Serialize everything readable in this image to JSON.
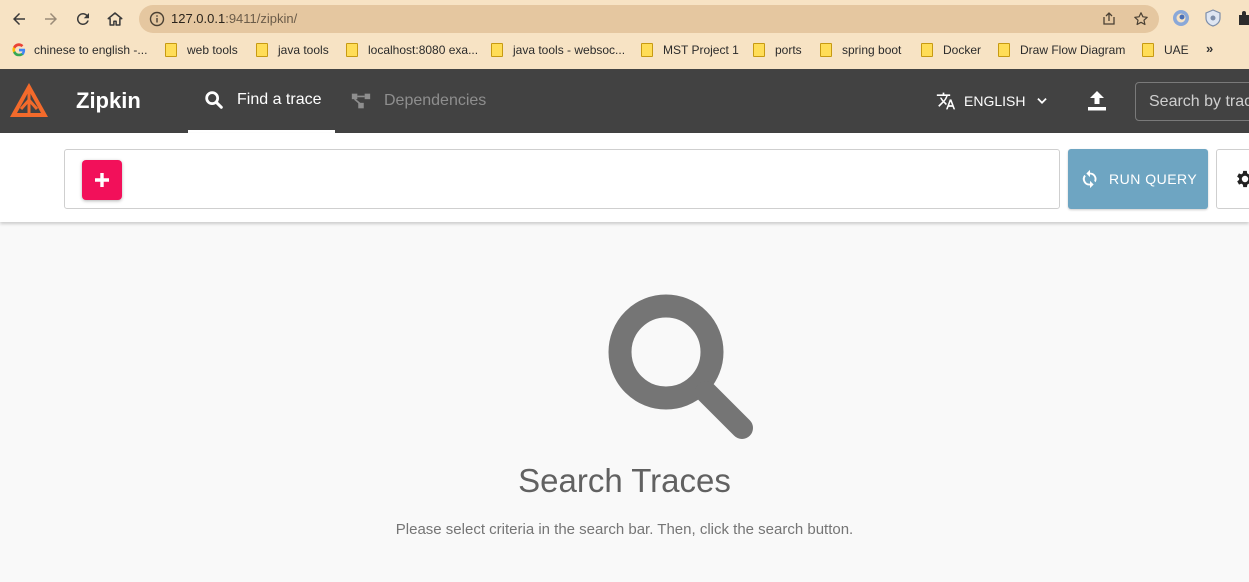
{
  "browser": {
    "url_host": "127.0.0.1",
    "url_port_path": ":9411/zipkin/",
    "bookmarks": [
      {
        "label": "chinese to english -..."
      },
      {
        "label": "web tools"
      },
      {
        "label": "java tools"
      },
      {
        "label": "localhost:8080 exa..."
      },
      {
        "label": "java tools - websoc..."
      },
      {
        "label": "MST Project 1"
      },
      {
        "label": "ports"
      },
      {
        "label": "spring boot"
      },
      {
        "label": "Docker"
      },
      {
        "label": "Draw Flow Diagram"
      },
      {
        "label": "UAE"
      }
    ],
    "more": "»"
  },
  "header": {
    "brand": "Zipkin",
    "tabs": [
      {
        "label": "Find a trace",
        "active": true
      },
      {
        "label": "Dependencies",
        "active": false
      }
    ],
    "language": "ENGLISH",
    "search_placeholder": "Search by trace ID"
  },
  "query": {
    "run_label": "RUN QUERY"
  },
  "empty_state": {
    "title": "Search Traces",
    "message": "Please select criteria in the search bar. Then, click the search button."
  },
  "colors": {
    "header_bg": "#424242",
    "add_button": "#f2105a",
    "run_button": "#6ea5c2",
    "logo_orange": "#f36a2b",
    "browser_bar": "#f7e3c4"
  }
}
